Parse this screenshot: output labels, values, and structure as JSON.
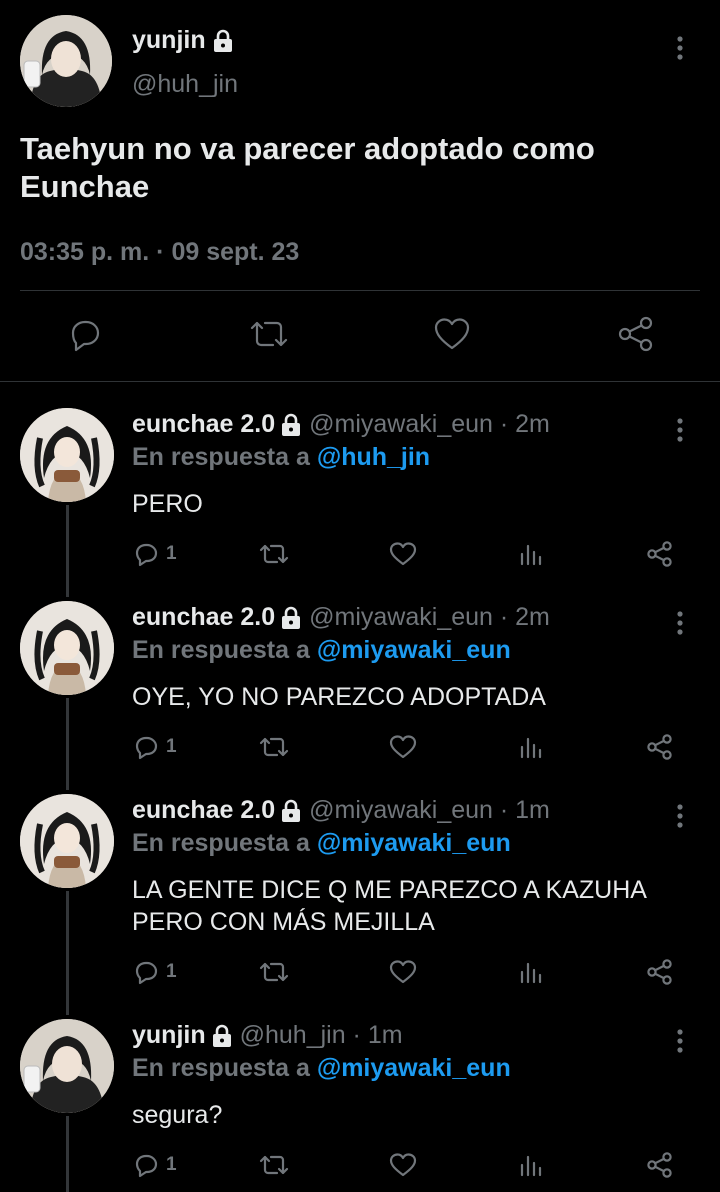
{
  "main_tweet": {
    "user": {
      "name": "yunjin",
      "handle": "@huh_jin",
      "locked": true
    },
    "text": "Taehyun no va parecer adoptado como Eunchae",
    "timestamp": "03:35 p. m. · 09 sept. 23",
    "actions": [
      "reply-icon",
      "retweet-icon",
      "like-icon",
      "share-icon"
    ]
  },
  "replies": [
    {
      "name": "eunchae 2.0",
      "handle": "@miyawaki_eun · 2m",
      "in_reply_label": "En respuesta a",
      "in_reply_to": "@huh_jin",
      "text": "PERO",
      "reply_count": "1"
    },
    {
      "name": "eunchae 2.0",
      "handle": "@miyawaki_eun · 2m",
      "in_reply_label": "En respuesta a",
      "in_reply_to": "@miyawaki_eun",
      "text": "OYE, YO NO PAREZCO ADOPTADA",
      "reply_count": "1"
    },
    {
      "name": "eunchae 2.0",
      "handle": "@miyawaki_eun · 1m",
      "in_reply_label": "En respuesta a",
      "in_reply_to": "@miyawaki_eun",
      "text": "LA GENTE DICE Q ME PAREZCO A KAZUHA PERO CON MÁS MEJILLA",
      "reply_count": "1"
    },
    {
      "name": "yunjin",
      "handle": "@huh_jin · 1m",
      "in_reply_label": "En respuesta a",
      "in_reply_to": "@miyawaki_eun",
      "text": "segura?",
      "reply_count": "1"
    }
  ],
  "colors": {
    "background": "#000000",
    "text": "#e7e9ea",
    "muted": "#71767b",
    "link": "#1d9bf0",
    "divider": "#2f3336"
  }
}
